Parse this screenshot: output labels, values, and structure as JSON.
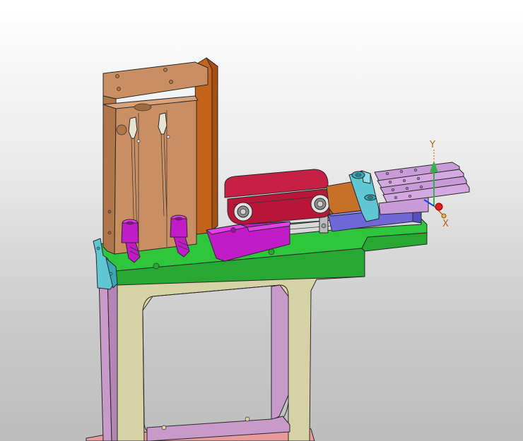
{
  "viewport": {
    "background_top": "#ffffff",
    "background_bottom": "#bdbdbd"
  },
  "triad": {
    "y_label": "Y",
    "x_label": "X",
    "y_color": "#2fb44a",
    "x_color": "#e02020",
    "z_color": "#1a3cff",
    "label_color": "#b4641e"
  },
  "parts": {
    "base_plate_color": "#2fc53c",
    "frame_color": "#d6d2a6",
    "frame_side_color": "#c79ac9",
    "cylinder_block_color": "#c98e62",
    "back_plate_color": "#c4641c",
    "linkage_arm_color": "#b8173a",
    "slide_block_color": "#d21cd2",
    "carrier_color": "#6e68d8",
    "clamp_block_color": "#5fc6d4",
    "gripper_fingers_color": "#c99ad8",
    "bracket_color": "#c7702a",
    "fitting_color": "#c21cc8",
    "bottom_plate_color": "#e89a9a"
  }
}
